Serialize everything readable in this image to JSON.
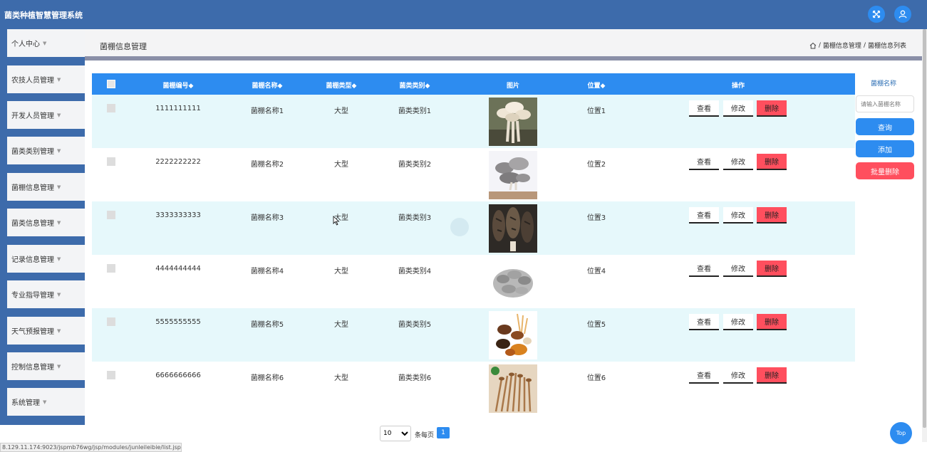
{
  "app": {
    "title": "菌类种植智慧管理系统"
  },
  "sidebar": {
    "items": [
      {
        "label": "个人中心"
      },
      {
        "label": "农技人员管理"
      },
      {
        "label": "开发人员管理"
      },
      {
        "label": "菌类类别管理"
      },
      {
        "label": "菌棚信息管理"
      },
      {
        "label": "菌类信息管理"
      },
      {
        "label": "记录信息管理"
      },
      {
        "label": "专业指导管理"
      },
      {
        "label": "天气预报管理"
      },
      {
        "label": "控制信息管理"
      },
      {
        "label": "系统管理"
      }
    ]
  },
  "header": {
    "title": "菌棚信息管理",
    "breadcrumb": [
      "菌棚信息管理",
      "菌棚信息列表"
    ],
    "separator": "/"
  },
  "table": {
    "columns": [
      "菌棚编号",
      "菌棚名称",
      "菌棚类型",
      "菌类类别",
      "图片",
      "位置",
      "操作"
    ],
    "sortable_mark": "◆",
    "rows": [
      {
        "id": "1111111111",
        "name": "菌棚名称1",
        "type": "大型",
        "category": "菌类类别1",
        "position": "位置1",
        "image_icon": "white-mushroom-cluster-photo"
      },
      {
        "id": "2222222222",
        "name": "菌棚名称2",
        "type": "大型",
        "category": "菌类类别2",
        "position": "位置2",
        "image_icon": "oyster-mushroom-photo"
      },
      {
        "id": "3333333333",
        "name": "菌棚名称3",
        "type": "大型",
        "category": "菌类类别3",
        "position": "位置3",
        "image_icon": "morel-mushroom-photo"
      },
      {
        "id": "4444444444",
        "name": "菌棚名称4",
        "type": "大型",
        "category": "菌类类别4",
        "position": "位置4",
        "image_icon": "maitake-mushroom-photo"
      },
      {
        "id": "5555555555",
        "name": "菌棚名称5",
        "type": "大型",
        "category": "菌类类别5",
        "position": "位置5",
        "image_icon": "mixed-mushrooms-photo"
      },
      {
        "id": "6666666666",
        "name": "菌棚名称6",
        "type": "大型",
        "category": "菌类类别6",
        "position": "位置6",
        "image_icon": "enoki-mushroom-photo"
      }
    ],
    "actions": {
      "view": "查看",
      "edit": "修改",
      "delete": "删除"
    }
  },
  "search": {
    "label": "菌棚名称",
    "placeholder": "请输入菌棚名称",
    "query_button": "查询",
    "add_button": "添加",
    "batch_delete_button": "批量删除"
  },
  "pagination": {
    "page_size": "10",
    "per_page_label": "条每页",
    "current_page": "1"
  },
  "top_button": "Top",
  "status_url": "8.129.11.174:9023/jspmb76wg/jsp/modules/junleileibie/list.jsp#",
  "colors": {
    "topbar": "#3d6bab",
    "accent": "#2d8cf0",
    "danger": "#ff4f5e",
    "row_stripe": "#e6f8fb"
  }
}
